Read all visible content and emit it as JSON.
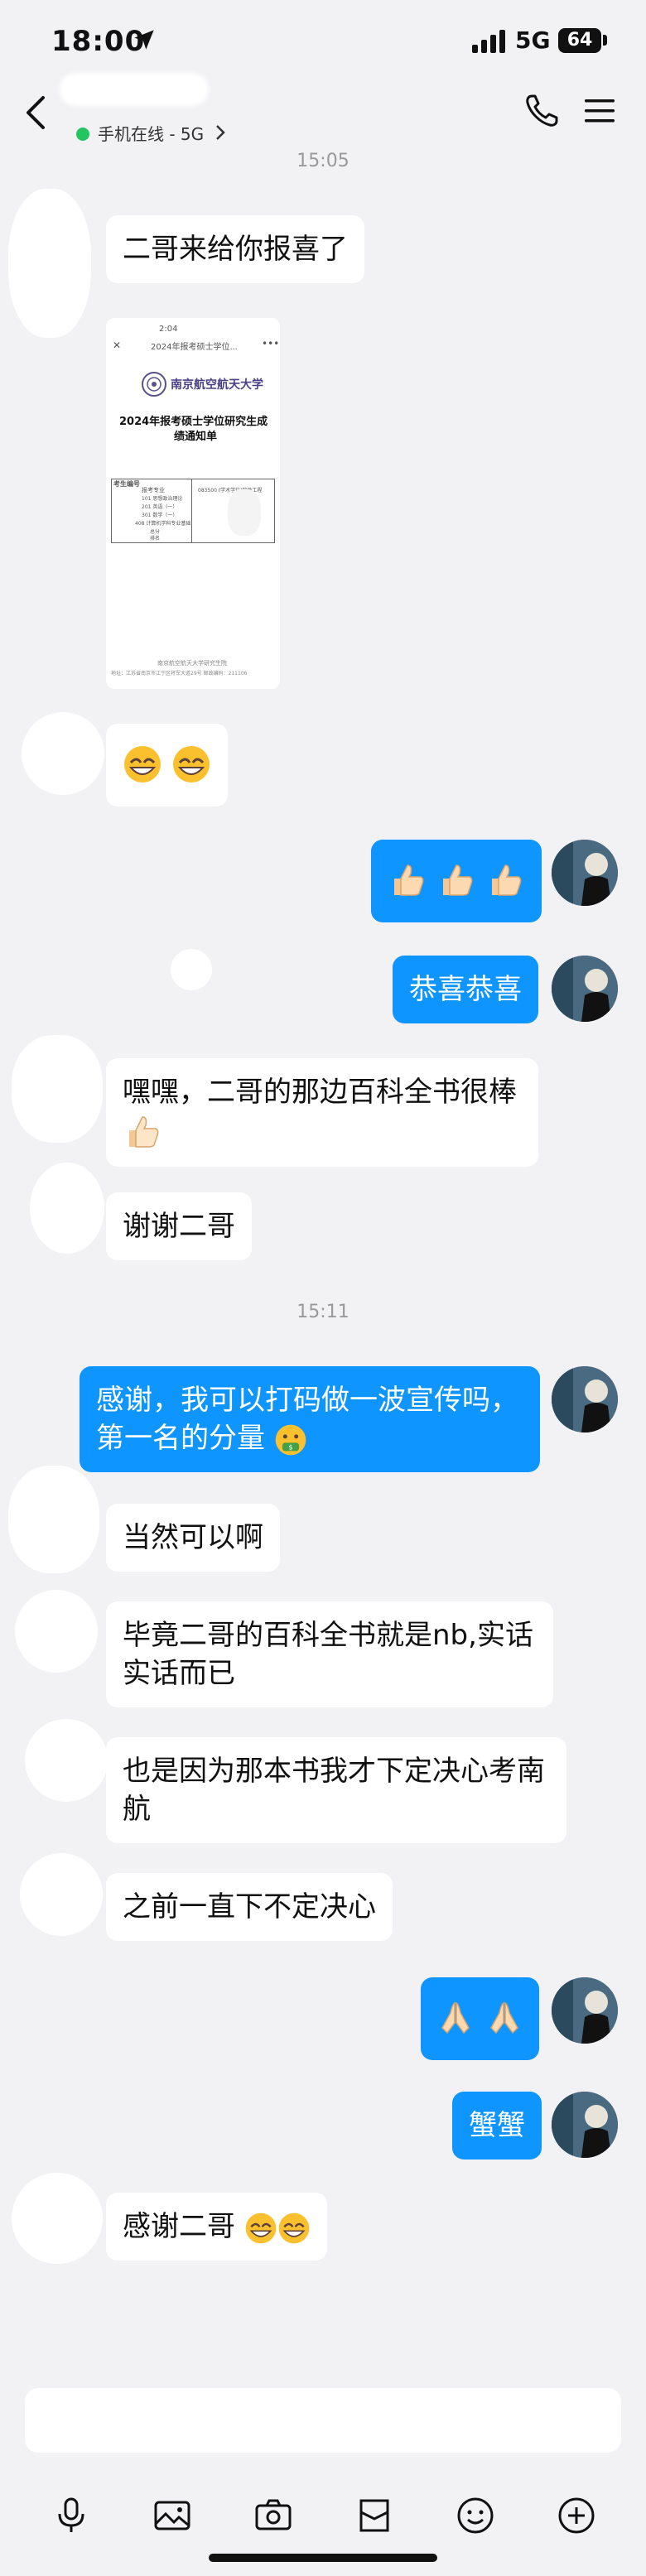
{
  "status": {
    "time": "18:00",
    "network": "5G",
    "battery": "64"
  },
  "header": {
    "online_status": "手机在线 - 5G"
  },
  "timestamps": [
    "15:05",
    "15:11"
  ],
  "messages": {
    "m1": "二哥来给你报喜了",
    "m5": "恭喜恭喜",
    "m6": "嘿嘿，二哥的那边百科全书很棒",
    "m7": "谢谢二哥",
    "m8_line1": "感谢，我可以打码做一波宣传吗，",
    "m8_line2": "第一名的分量",
    "m9": "当然可以啊",
    "m10_line1": "毕竟二哥的百科全书就是nb,实话",
    "m10_line2": "实话而已",
    "m11_line1": "也是因为那本书我才下定决心考南",
    "m11_line2": "航",
    "m12": "之前一直下不定决心",
    "m14": "蟹蟹",
    "m15": "感谢二哥"
  },
  "shared_image": {
    "time": "2:04",
    "page_title": "2024年报考硕士学位...",
    "school": "南京航空航天大学",
    "doc_title_line1": "2024年报考硕士学位研究生成",
    "doc_title_line2": "绩通知单",
    "col_header": "考生编号",
    "row_label": "报考专业",
    "code": "083500 (学术学位)软件工程",
    "subjects": [
      "101 思想政治理论",
      "201 英语（一）",
      "301 数学（一）",
      "408 计算机学科专业基础",
      "总分",
      "排名"
    ],
    "footer_line1": "南京航空航天大学研究生院",
    "footer_line2": "地址：江苏省南京市江宁区将军大道29号   邮政编码：211106"
  },
  "colors": {
    "bubble_self": "#0e95ff",
    "bubble_other": "#ffffff",
    "background": "#f2f2f5",
    "online": "#22c55e"
  },
  "icons": [
    "location-arrow-icon",
    "signal-icon",
    "back-icon",
    "chevron-right-icon",
    "phone-icon",
    "menu-icon",
    "grinning-emoji",
    "thumbs-up-emoji",
    "money-mouth-emoji",
    "pray-emoji",
    "microphone-icon",
    "image-icon",
    "camera-icon",
    "file-icon",
    "smile-icon",
    "plus-icon"
  ]
}
